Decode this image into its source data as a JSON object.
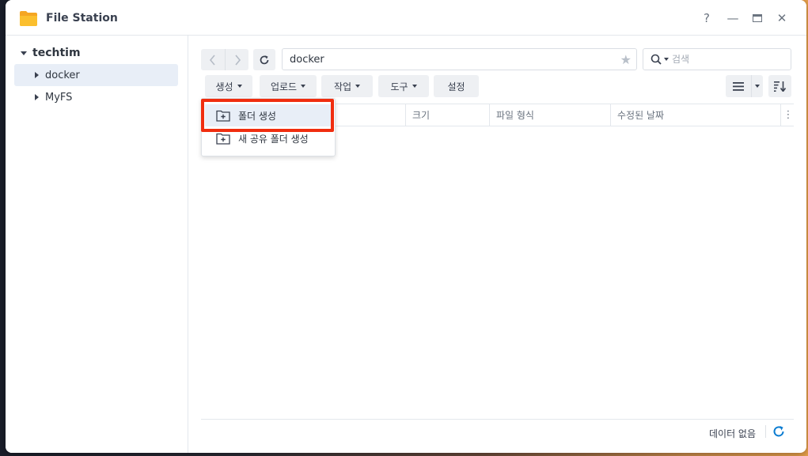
{
  "window": {
    "title": "File Station",
    "help_label": "?",
    "minimize_label": "—",
    "maximize_label": "□",
    "close_label": "✕"
  },
  "sidebar": {
    "root": "techtim",
    "items": [
      {
        "label": "docker",
        "active": true
      },
      {
        "label": "MyFS",
        "active": false
      }
    ]
  },
  "pathbar": {
    "path": "docker",
    "search_placeholder": "검색"
  },
  "toolbar": {
    "create_label": "생성",
    "upload_label": "업로드",
    "action_label": "작업",
    "tools_label": "도구",
    "settings_label": "설정"
  },
  "columns": [
    "크기",
    "파일 형식",
    "수정된 날짜"
  ],
  "create_menu": {
    "items": [
      {
        "label": "폴더 생성",
        "highlighted": true
      },
      {
        "label": "새 공유 폴더 생성",
        "highlighted": false
      }
    ]
  },
  "footer": {
    "status": "데이터 없음"
  },
  "colors": {
    "accent": "#0b7cd1",
    "highlight_border": "#f02d0f",
    "folder_icon": "#f5a623"
  }
}
